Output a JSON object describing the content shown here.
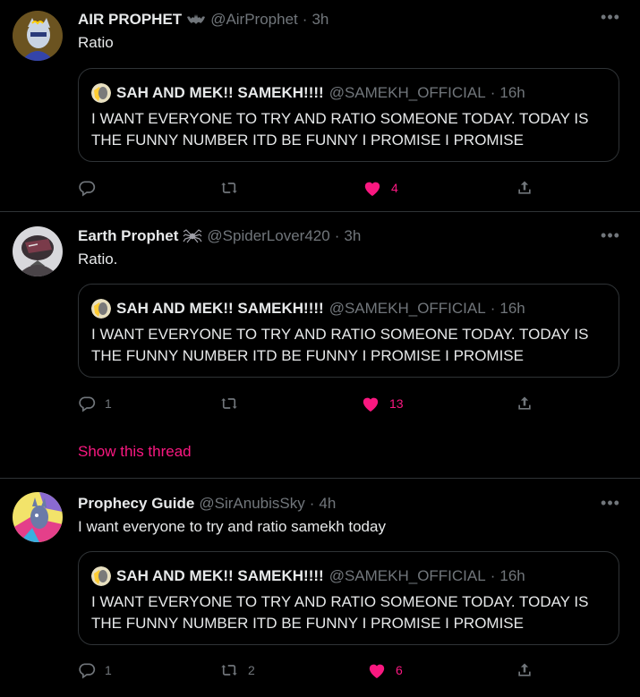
{
  "colors": {
    "background": "#000000",
    "text": "#e7e9ea",
    "secondary": "#71767b",
    "border": "#2f3336",
    "like": "#f91880"
  },
  "quoted": {
    "name": "SAH AND MEK!! SAMEKH!!!!",
    "handle": "@SAMEKH_OFFICIAL",
    "time": "16h",
    "text": "I WANT EVERYONE TO TRY AND RATIO SOMEONE TODAY. TODAY IS THE FUNNY NUMBER ITD BE FUNNY I PROMISE I PROMISE"
  },
  "tweets": [
    {
      "name": "AIR PROPHET",
      "badge_icon": "bat-icon",
      "handle": "@AirProphet",
      "dot": "·",
      "time": "3h",
      "more": "•••",
      "text": "Ratio",
      "replies": "",
      "retweets": "",
      "likes": "4",
      "liked": true
    },
    {
      "name": "Earth Prophet",
      "badge_icon": "spider-icon",
      "handle": "@SpiderLover420",
      "dot": "·",
      "time": "3h",
      "more": "•••",
      "text": "Ratio.",
      "replies": "1",
      "retweets": "",
      "likes": "13",
      "liked": true,
      "show_thread": "Show this thread"
    },
    {
      "name": "Prophecy Guide",
      "handle": "@SirAnubisSky",
      "dot": "·",
      "time": "4h",
      "more": "•••",
      "text": "I want everyone to try and ratio samekh today",
      "replies": "1",
      "retweets": "2",
      "likes": "6",
      "liked": true
    }
  ]
}
